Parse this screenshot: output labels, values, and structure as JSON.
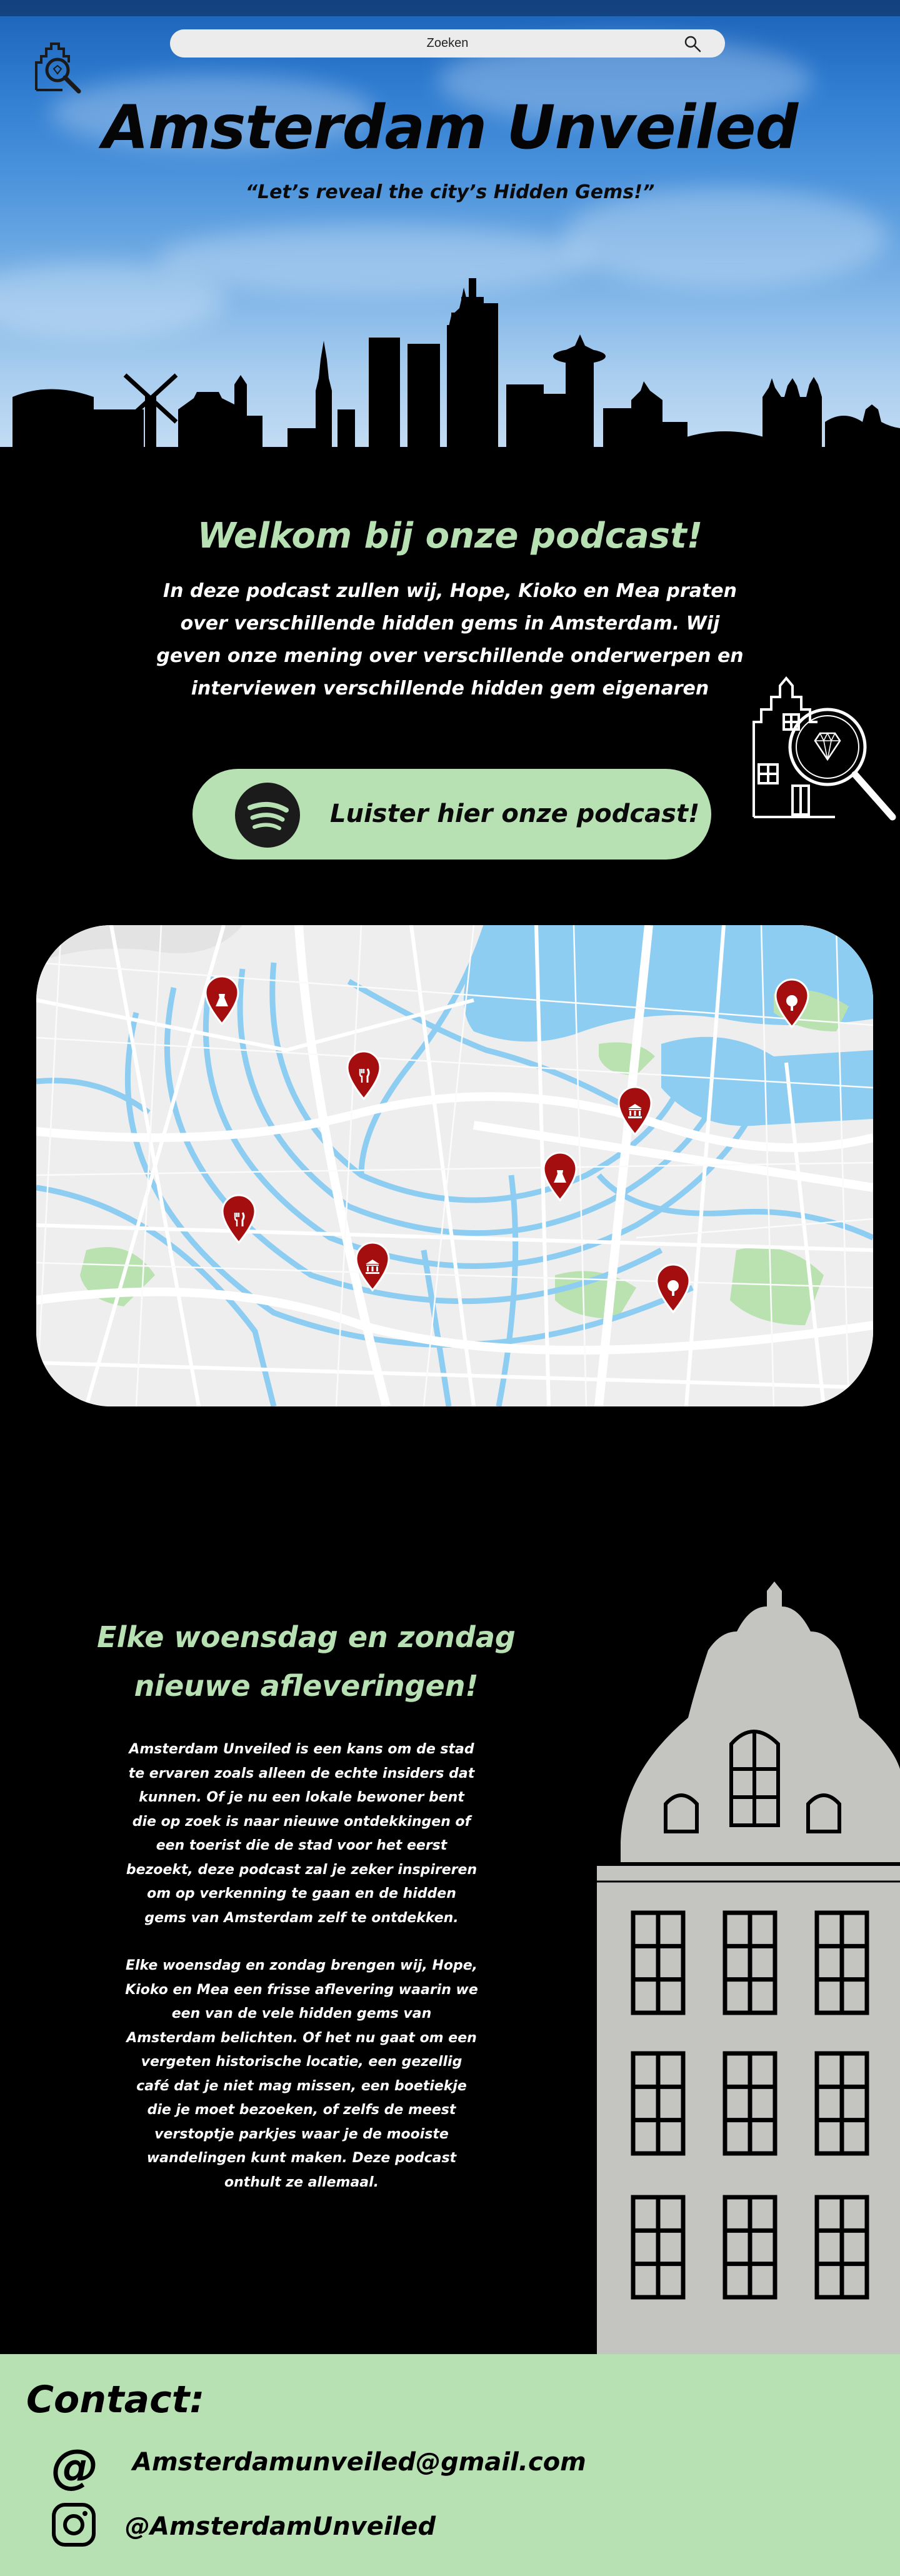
{
  "search": {
    "placeholder": "Zoeken"
  },
  "hero": {
    "title": "Amsterdam Unveiled",
    "subtitle": "“Let’s reveal the city’s Hidden Gems!”"
  },
  "welcome": {
    "title": "Welkom bij onze podcast!",
    "text": "In deze  podcast zullen wij, Hope, Kioko en Mea praten over verschillende hidden gems in Amsterdam. Wij geven onze mening over verschillende onderwerpen en interviewen verschillende hidden gem eigenaren",
    "listen_label": "Luister hier onze podcast!"
  },
  "map": {
    "pins": [
      {
        "type": "dress",
        "icon": "dress-icon"
      },
      {
        "type": "food",
        "icon": "cutlery-icon"
      },
      {
        "type": "museum",
        "icon": "museum-icon"
      },
      {
        "type": "dress",
        "icon": "dress-icon"
      },
      {
        "type": "food",
        "icon": "cutlery-icon"
      },
      {
        "type": "museum",
        "icon": "museum-icon"
      },
      {
        "type": "park",
        "icon": "tree-icon"
      },
      {
        "type": "park",
        "icon": "tree-icon"
      }
    ],
    "pin_color": "#a50e0e"
  },
  "episodes": {
    "title_line1": "Elke woensdag en zondag",
    "title_line2": "nieuwe afleveringen!",
    "paragraph1": "Amsterdam Unveiled is een kans om de stad te ervaren zoals alleen de echte insiders dat kunnen. Of je nu een lokale bewoner bent die op zoek is naar nieuwe ontdekkingen of een toerist die de stad voor het eerst bezoekt, deze podcast zal je zeker inspireren om op verkenning te gaan en de hidden gems van Amsterdam zelf te ontdekken.",
    "paragraph2": "Elke woensdag en zondag brengen wij, Hope, Kioko en Mea een frisse aflevering waarin we een van de vele hidden gems van Amsterdam belichten. Of het nu gaat om een vergeten historische locatie, een gezellig café dat je niet mag missen, een boetiekje die je moet bezoeken, of zelfs de meest verstoptje parkjes waar je de mooiste wandelingen kunt maken. Deze podcast onthult ze allemaal."
  },
  "contact": {
    "title": "Contact:",
    "at_symbol": "@",
    "email": "Amsterdamunveiled@gmail.com",
    "instagram": "@AmsterdamUnveiled"
  },
  "colors": {
    "accent_green": "#b7e1b3",
    "background": "#000000",
    "facade_gray": "#c4c4c0",
    "pin_red": "#a50e0e"
  }
}
